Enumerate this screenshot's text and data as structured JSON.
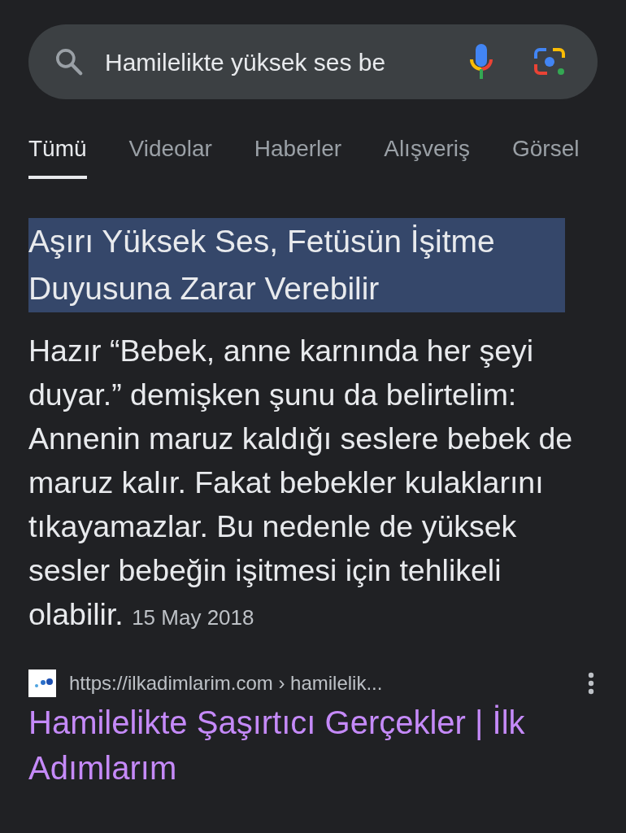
{
  "search": {
    "query": "Hamilelikte yüksek ses be"
  },
  "tabs": [
    {
      "label": "Tümü",
      "selected": true
    },
    {
      "label": "Videolar",
      "selected": false
    },
    {
      "label": "Haberler",
      "selected": false
    },
    {
      "label": "Alışveriş",
      "selected": false
    },
    {
      "label": "Görsel",
      "selected": false
    }
  ],
  "snippet": {
    "heading": "Aşırı Yüksek Ses, Fetüsün İşitme Duyusuna Zarar Verebilir",
    "heading_highlighted": true,
    "text": "Hazır “Bebek, anne karnında her şeyi duyar.” demişken şunu da belirtelim: Annenin maruz kaldığı seslere bebek de maruz kalır. Fakat bebekler kulaklarını tıkayamazlar. Bu nedenle de yüksek sesler bebeğin işitmesi için tehlikeli olabilir.",
    "date": "15 May 2018"
  },
  "result": {
    "url": "https://ilkadimlarim.com › hamilelik...",
    "title": "Hamilelikte Şaşırtıcı Gerçekler | İlk Adımlarım",
    "visited": true
  }
}
